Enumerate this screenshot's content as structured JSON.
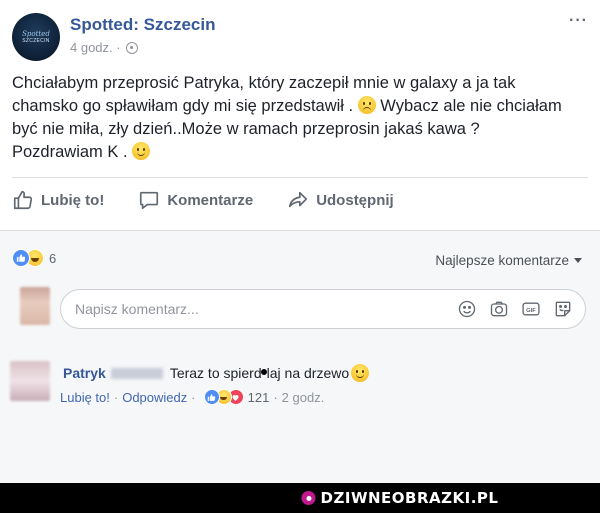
{
  "post": {
    "page_name": "Spotted: Szczecin",
    "avatar_line1": "Spotted",
    "avatar_line2": "SZCZECIN",
    "time": "4 godz. ·",
    "more": "···",
    "text_part1": "Chciałabym przeprosić Patryka, który zaczepił mnie w galaxy a ja tak chamsko go spławiłam gdy mi się przedstawił . ",
    "text_part2": " Wybacz ale nie chciałam być nie miła, zły dzień..Może w ramach przeprosin jakaś kawa ? Pozdrawiam K . ",
    "emoji1": "sad-face",
    "emoji2": "smiley-face"
  },
  "actions": {
    "like": "Lubię to!",
    "comment": "Komentarze",
    "share": "Udostępnij"
  },
  "comments_section": {
    "reaction_count": "6",
    "sort_label": "Najlepsze komentarze",
    "input_placeholder": "Napisz komentarz...",
    "input_icons": [
      "emoji-icon",
      "camera-icon",
      "gif-icon",
      "sticker-icon"
    ]
  },
  "comment": {
    "author": "Patryk",
    "text_before": "Teraz to spierd",
    "text_after": "laj na drzewo ",
    "like_label": "Lubię to!",
    "reply_label": "Odpowiedz",
    "reaction_count": "121",
    "time": "2 godz."
  },
  "watermark": {
    "text": "DZIWNEOBRAZKI.PL"
  },
  "colors": {
    "link_blue": "#365899",
    "text_gray": "#606770",
    "like_blue": "#4f8ef7",
    "love_red": "#f0435b",
    "watermark_pink": "#c2188d"
  }
}
